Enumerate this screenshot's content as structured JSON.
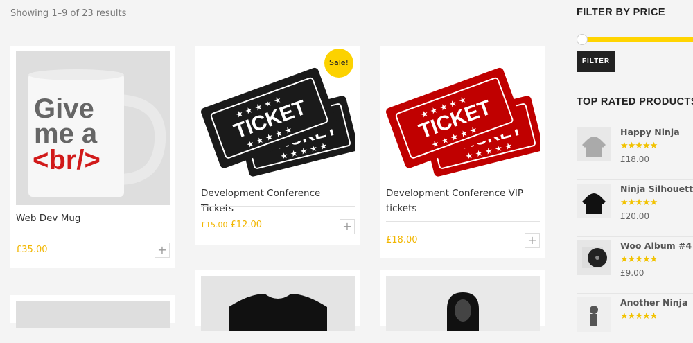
{
  "result_count": "Showing 1–9 of 23 results",
  "products": [
    {
      "title": "Web Dev Mug",
      "price": "£35.00",
      "old_price": "",
      "sale": ""
    },
    {
      "title": "Development Conference Tickets",
      "price": "£12.00",
      "old_price": "£15.00",
      "sale": "Sale!"
    },
    {
      "title": "Development Conference VIP tickets",
      "price": "£18.00",
      "old_price": "",
      "sale": ""
    }
  ],
  "mug_text": [
    "Give",
    "me a",
    "<br/>"
  ],
  "ticket_word": "TICKET",
  "add_icon": "+",
  "sidebar": {
    "filter_heading": "FILTER BY PRICE",
    "filter_button": "FILTER",
    "top_rated_heading": "TOP RATED PRODUCTS",
    "top_rated": [
      {
        "name": "Happy Ninja",
        "stars": "★★★★★",
        "price": "£18.00"
      },
      {
        "name": "Ninja Silhouette",
        "stars": "★★★★★",
        "price": "£20.00"
      },
      {
        "name": "Woo Album #4",
        "stars": "★★★★★",
        "price": "£9.00"
      },
      {
        "name": "Another Ninja",
        "stars": "★★★★★",
        "price": ""
      }
    ]
  },
  "colors": {
    "accent": "#f2b600",
    "sale_badge": "#fcd200",
    "ticket_black": "#1a1a1a",
    "ticket_red": "#c00000",
    "mug_red": "#d11a1a"
  }
}
